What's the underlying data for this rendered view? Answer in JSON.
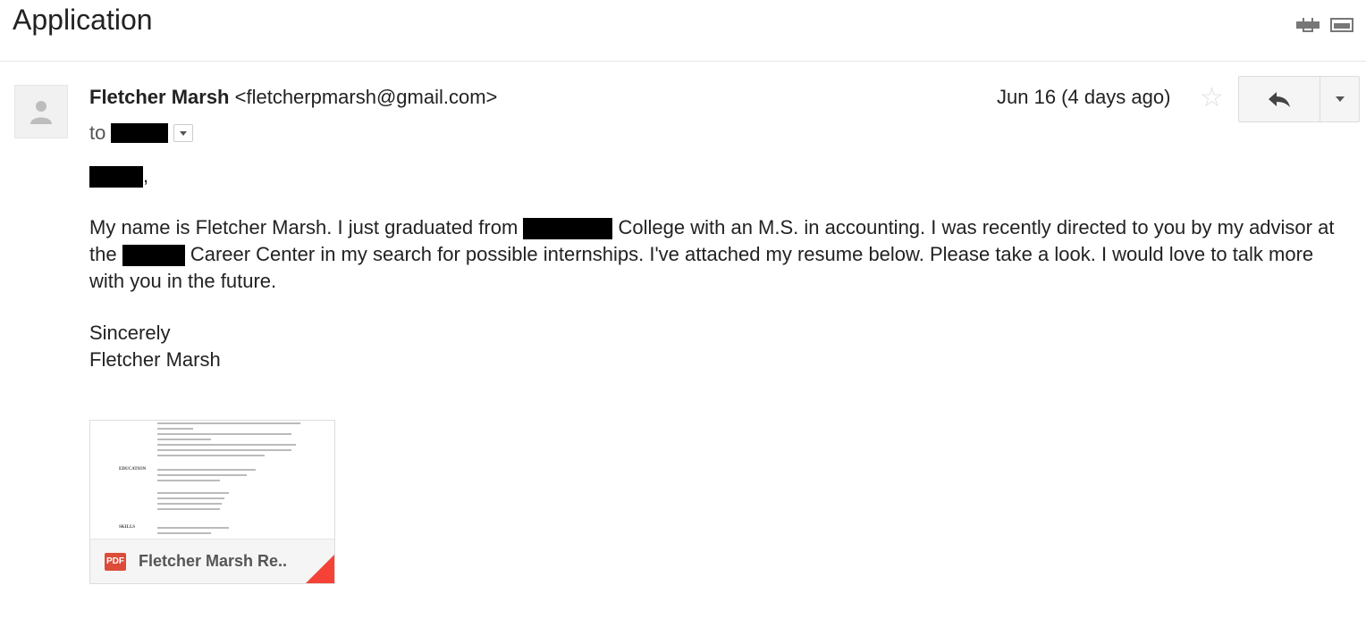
{
  "subject": "Application",
  "sender": {
    "name": "Fletcher Marsh",
    "email": "<fletcherpmarsh@gmail.com>",
    "to_prefix": "to"
  },
  "date": "Jun 16 (4 days ago)",
  "icons": {
    "print": "print-icon",
    "popout": "new-window-icon",
    "avatar": "person-icon",
    "star": "star-icon",
    "reply": "reply-icon",
    "more": "chevron-down-icon",
    "pdf": "pdf-icon"
  },
  "body": {
    "greeting_suffix": ",",
    "para_part1": "My name is Fletcher Marsh. I just graduated from ",
    "para_part2": " College with an M.S. in accounting. I was recently directed to you by my advisor at the ",
    "para_part3": " Career Center in my search for possible internships. I've attached my resume below. Please take a look. I would love to talk more with you in the future.",
    "closing": "Sincerely",
    "signature": "Fletcher Marsh"
  },
  "attachment": {
    "badge": "PDF",
    "name": "Fletcher Marsh Re..",
    "preview": {
      "education_label": "EDUCATION",
      "skills_label": "SKILLS"
    }
  },
  "colors": {
    "pdf_red": "#dd4b39",
    "corner_accent": "#f44336",
    "redaction": "#000000"
  }
}
